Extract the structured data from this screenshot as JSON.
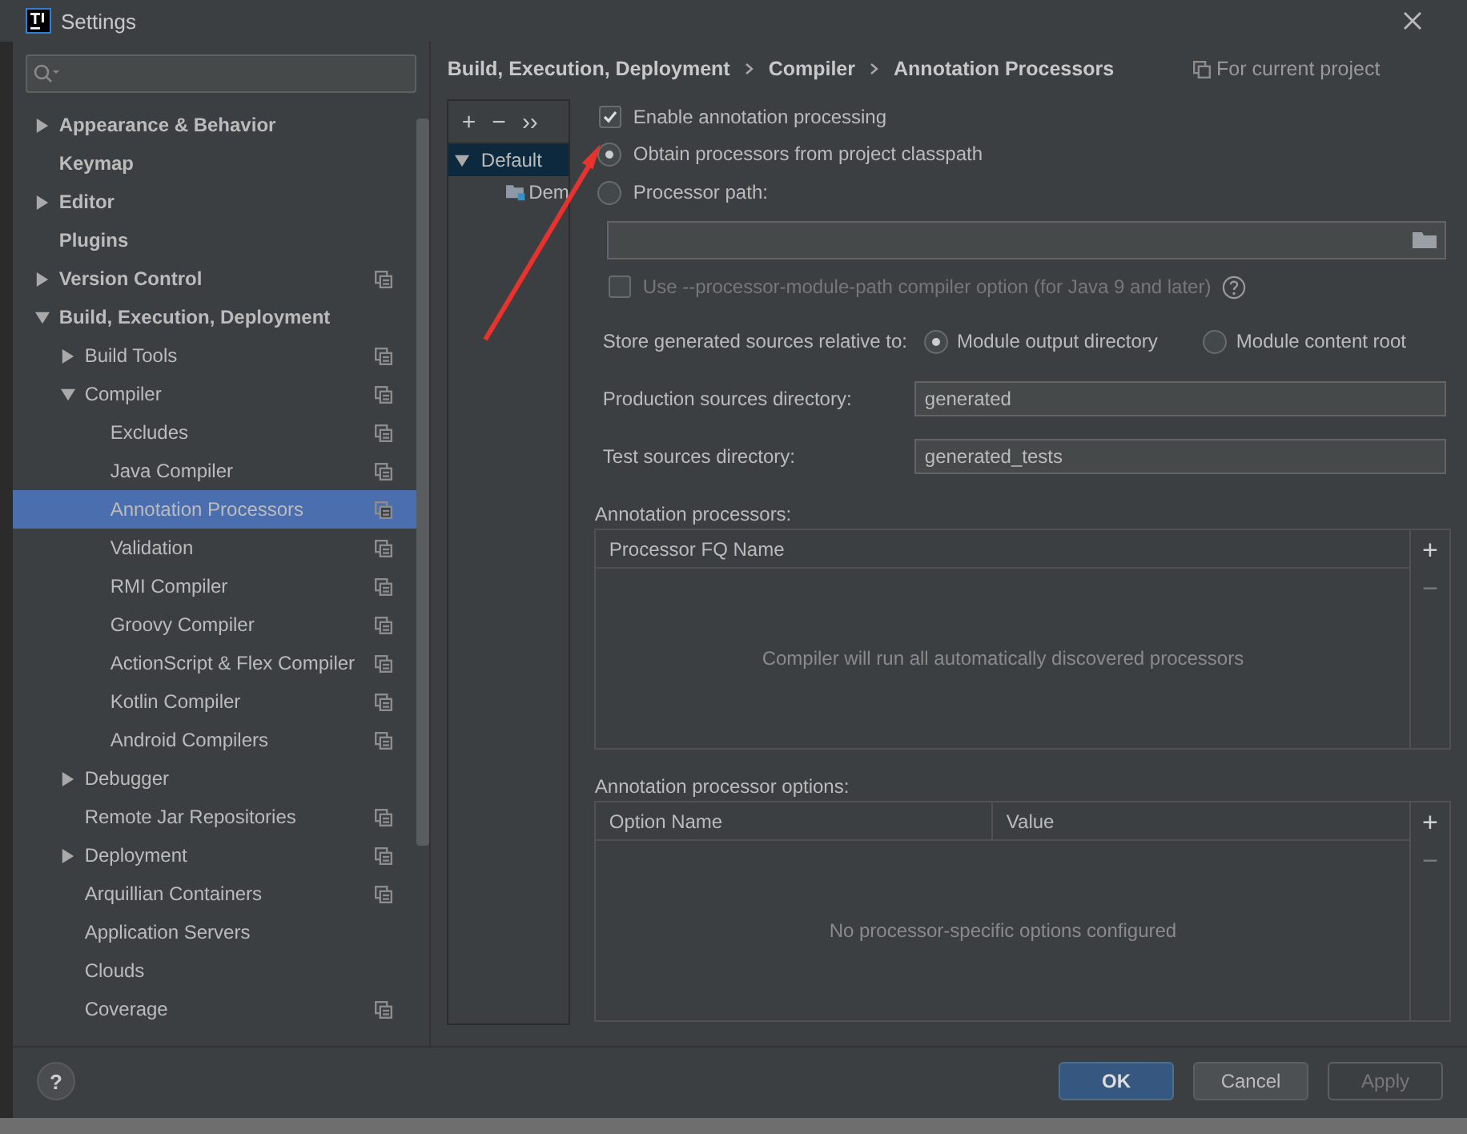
{
  "window": {
    "title": "Settings"
  },
  "sidebar": {
    "items": [
      {
        "label": "Appearance & Behavior",
        "expanded": false,
        "per_project": false,
        "selected": false
      },
      {
        "label": "Keymap",
        "per_project": false,
        "selected": false
      },
      {
        "label": "Editor",
        "expanded": false,
        "per_project": false,
        "selected": false
      },
      {
        "label": "Plugins",
        "per_project": false,
        "selected": false
      },
      {
        "label": "Version Control",
        "expanded": false,
        "per_project": true,
        "selected": false
      },
      {
        "label": "Build, Execution, Deployment",
        "expanded": true,
        "per_project": false,
        "selected": false,
        "children": [
          {
            "label": "Build Tools",
            "expanded": false,
            "per_project": true,
            "selected": false
          },
          {
            "label": "Compiler",
            "expanded": true,
            "per_project": true,
            "selected": false,
            "children": [
              {
                "label": "Excludes",
                "per_project": true,
                "selected": false
              },
              {
                "label": "Java Compiler",
                "per_project": true,
                "selected": false
              },
              {
                "label": "Annotation Processors",
                "per_project": true,
                "selected": true
              },
              {
                "label": "Validation",
                "per_project": true,
                "selected": false
              },
              {
                "label": "RMI Compiler",
                "per_project": true,
                "selected": false
              },
              {
                "label": "Groovy Compiler",
                "per_project": true,
                "selected": false
              },
              {
                "label": "ActionScript & Flex Compiler",
                "per_project": true,
                "selected": false
              },
              {
                "label": "Kotlin Compiler",
                "per_project": true,
                "selected": false
              },
              {
                "label": "Android Compilers",
                "per_project": true,
                "selected": false
              }
            ]
          },
          {
            "label": "Debugger",
            "expanded": false,
            "per_project": false,
            "selected": false
          },
          {
            "label": "Remote Jar Repositories",
            "per_project": true,
            "selected": false
          },
          {
            "label": "Deployment",
            "expanded": false,
            "per_project": true,
            "selected": false
          },
          {
            "label": "Arquillian Containers",
            "per_project": true,
            "selected": false
          },
          {
            "label": "Application Servers",
            "per_project": false,
            "selected": false
          },
          {
            "label": "Clouds",
            "per_project": false,
            "selected": false
          },
          {
            "label": "Coverage",
            "per_project": true,
            "selected": false
          }
        ]
      }
    ]
  },
  "breadcrumb": [
    "Build, Execution, Deployment",
    "Compiler",
    "Annotation Processors"
  ],
  "scope_note": "For current project",
  "profiles": {
    "toolbar": [
      "+",
      "−",
      "››"
    ],
    "items": [
      {
        "label": "Default",
        "expanded": true,
        "selected": true,
        "children": [
          {
            "label": "Dem",
            "selected": false
          }
        ]
      }
    ]
  },
  "enable_processing": {
    "label": "Enable annotation processing",
    "checked": true
  },
  "processor_source": [
    {
      "label": "Obtain processors from project classpath",
      "selected": true
    },
    {
      "label": "Processor path:",
      "selected": false
    }
  ],
  "module_path_option": {
    "label": "Use --processor-module-path compiler option (for Java 9 and later)",
    "checked": false,
    "disabled": true
  },
  "store_relative": {
    "label": "Store generated sources relative to:",
    "options": [
      {
        "label": "Module output directory",
        "selected": true
      },
      {
        "label": "Module content root",
        "selected": false
      }
    ]
  },
  "directories": [
    {
      "label": "Production sources directory:",
      "value": "generated"
    },
    {
      "label": "Test sources directory:",
      "value": "generated_tests"
    }
  ],
  "tables": [
    {
      "title": "Annotation processors:",
      "columns": [
        "Processor FQ Name"
      ],
      "empty_text": "Compiler will run all automatically discovered processors",
      "toolbar": [
        {
          "label": "+",
          "disabled": false
        },
        {
          "label": "−",
          "disabled": true
        }
      ]
    },
    {
      "title": "Annotation processor options:",
      "columns": [
        "Option Name",
        "Value"
      ],
      "empty_text": "No processor-specific options configured",
      "toolbar": [
        {
          "label": "+",
          "disabled": false
        },
        {
          "label": "−",
          "disabled": true
        }
      ]
    }
  ],
  "help": "?",
  "buttons": [
    {
      "label": "OK",
      "kind": "primary"
    },
    {
      "label": "Cancel",
      "kind": "normal"
    },
    {
      "label": "Apply",
      "kind": "disabled"
    }
  ]
}
